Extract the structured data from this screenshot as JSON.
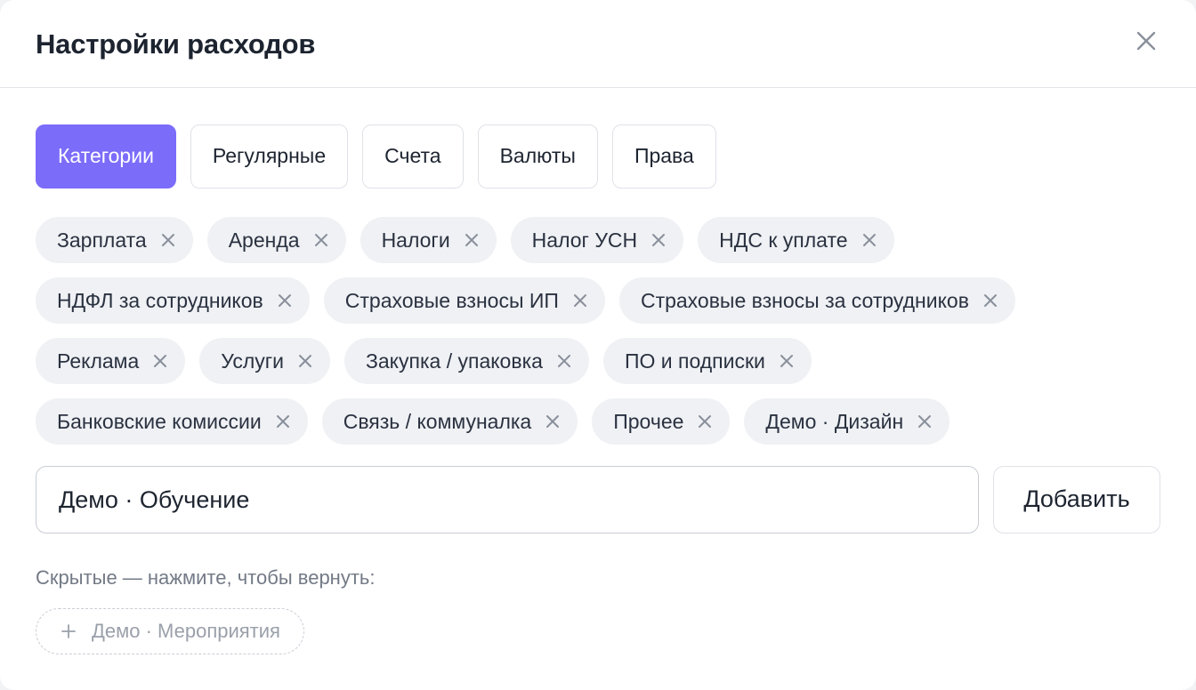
{
  "dialog": {
    "title": "Настройки расходов"
  },
  "tabs": [
    {
      "label": "Категории",
      "active": true
    },
    {
      "label": "Регулярные",
      "active": false
    },
    {
      "label": "Счета",
      "active": false
    },
    {
      "label": "Валюты",
      "active": false
    },
    {
      "label": "Права",
      "active": false
    }
  ],
  "categories": [
    [
      "Зарплата",
      "Аренда",
      "Налоги",
      "Налог УСН",
      "НДС к уплате"
    ],
    [
      "НДФЛ за сотрудников",
      "Страховые взносы ИП",
      "Страховые взносы за сотрудников"
    ],
    [
      "Реклама",
      "Услуги",
      "Закупка / упаковка",
      "ПО и подписки"
    ],
    [
      "Банковские комиссии",
      "Связь / коммуналка",
      "Прочее",
      "Демо · Дизайн"
    ]
  ],
  "new_category": {
    "value": "Демо · Обучение",
    "add_label": "Добавить"
  },
  "hidden": {
    "label": "Скрытые — нажмите, чтобы вернуть:",
    "items": [
      "Демо · Мероприятия"
    ]
  },
  "colors": {
    "accent": "#7c6cfa",
    "chip_bg": "#eff1f4",
    "text": "#1d2430",
    "muted": "#737a86"
  },
  "icons": {
    "close": "close-icon",
    "chip_remove": "x-icon",
    "restore": "plus-icon"
  }
}
